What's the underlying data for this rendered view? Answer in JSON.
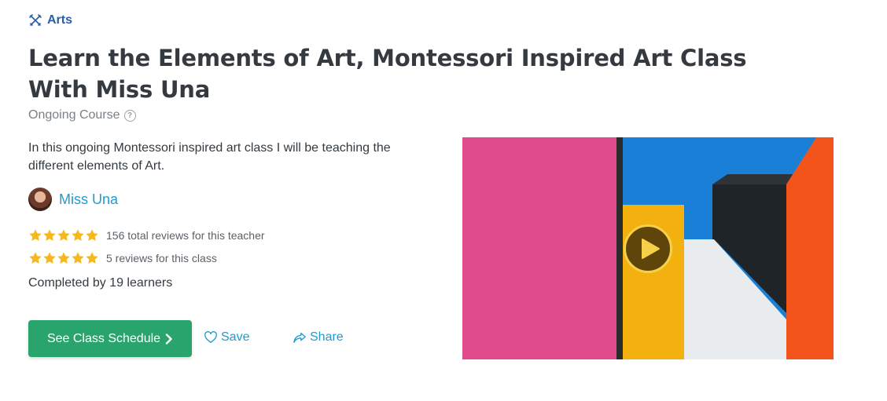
{
  "category": {
    "label": "Arts",
    "icon": "brush-pencil-icon"
  },
  "title": "Learn the Elements of Art, Montessori Inspired Art Class With Miss Una",
  "course_type": {
    "label": "Ongoing Course",
    "icon": "question-circle-icon"
  },
  "description": "In this ongoing Montessori inspired art class I will be teaching the different elements of Art.",
  "teacher": {
    "name": "Miss Una"
  },
  "ratings": [
    {
      "stars": 5,
      "text": "156 total reviews for this teacher"
    },
    {
      "stars": 5,
      "text": "5 reviews for this class"
    }
  ],
  "completed": "Completed by 19 learners",
  "actions": {
    "schedule_label": "See Class Schedule",
    "save_label": "Save",
    "share_label": "Share"
  },
  "colors": {
    "primary_button": "#28a46c",
    "link": "#1f9bd0",
    "category": "#2a5ea8",
    "star": "#f5b91e"
  }
}
